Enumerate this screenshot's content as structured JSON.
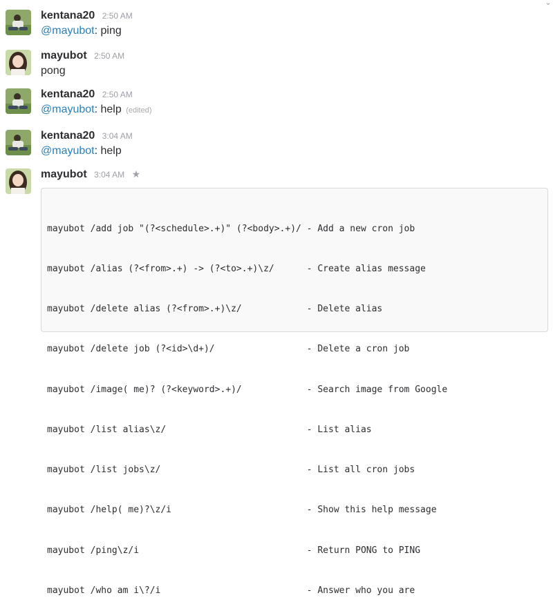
{
  "messages": [
    {
      "author": "kentana20",
      "time": "2:50 AM",
      "mention": "@mayubot",
      "sep": ":",
      "text": " ping",
      "avatar": "kentana20-avatar"
    },
    {
      "author": "mayubot",
      "time": "2:50 AM",
      "text": "pong",
      "avatar": "mayubot-avatar"
    },
    {
      "author": "kentana20",
      "time": "2:50 AM",
      "mention": "@mayubot",
      "sep": ":",
      "text": " help",
      "edited": "(edited)",
      "avatar": "kentana20-avatar"
    },
    {
      "author": "kentana20",
      "time": "3:04 AM",
      "mention": "@mayubot",
      "sep": ":",
      "text": " help",
      "avatar": "kentana20-avatar"
    },
    {
      "author": "mayubot",
      "time": "3:04 AM",
      "star_icon": "star-icon",
      "avatar": "mayubot-avatar"
    }
  ],
  "help_lines": [
    "mayubot /add job \"(?<schedule>.+)\" (?<body>.+)/ - Add a new cron job",
    "mayubot /alias (?<from>.+) -> (?<to>.+)\\z/      - Create alias message",
    "mayubot /delete alias (?<from>.+)\\z/            - Delete alias",
    "mayubot /delete job (?<id>\\d+)/                 - Delete a cron job",
    "mayubot /image( me)? (?<keyword>.+)/            - Search image from Google",
    "mayubot /list alias\\z/                          - List alias",
    "mayubot /list jobs\\z/                           - List all cron jobs",
    "mayubot /help( me)?\\z/i                         - Show this help message",
    "mayubot /ping\\z/i                               - Return PONG to PING",
    "mayubot /who am i\\?/i                           - Answer who you are"
  ],
  "colors": {
    "mention": "#2a80b9",
    "timestamp": "#9e9ea6",
    "text": "#2c2d30"
  }
}
